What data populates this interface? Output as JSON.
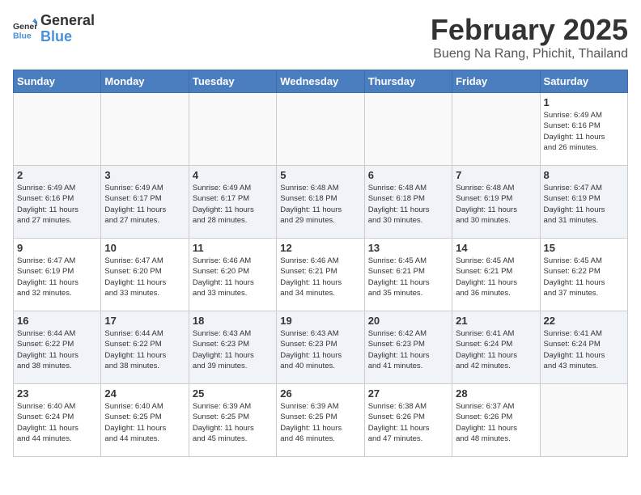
{
  "logo": {
    "general": "General",
    "blue": "Blue"
  },
  "header": {
    "month_year": "February 2025",
    "location": "Bueng Na Rang, Phichit, Thailand"
  },
  "weekdays": [
    "Sunday",
    "Monday",
    "Tuesday",
    "Wednesday",
    "Thursday",
    "Friday",
    "Saturday"
  ],
  "weeks": [
    [
      {
        "day": "",
        "info": ""
      },
      {
        "day": "",
        "info": ""
      },
      {
        "day": "",
        "info": ""
      },
      {
        "day": "",
        "info": ""
      },
      {
        "day": "",
        "info": ""
      },
      {
        "day": "",
        "info": ""
      },
      {
        "day": "1",
        "info": "Sunrise: 6:49 AM\nSunset: 6:16 PM\nDaylight: 11 hours\nand 26 minutes."
      }
    ],
    [
      {
        "day": "2",
        "info": "Sunrise: 6:49 AM\nSunset: 6:16 PM\nDaylight: 11 hours\nand 27 minutes."
      },
      {
        "day": "3",
        "info": "Sunrise: 6:49 AM\nSunset: 6:17 PM\nDaylight: 11 hours\nand 27 minutes."
      },
      {
        "day": "4",
        "info": "Sunrise: 6:49 AM\nSunset: 6:17 PM\nDaylight: 11 hours\nand 28 minutes."
      },
      {
        "day": "5",
        "info": "Sunrise: 6:48 AM\nSunset: 6:18 PM\nDaylight: 11 hours\nand 29 minutes."
      },
      {
        "day": "6",
        "info": "Sunrise: 6:48 AM\nSunset: 6:18 PM\nDaylight: 11 hours\nand 30 minutes."
      },
      {
        "day": "7",
        "info": "Sunrise: 6:48 AM\nSunset: 6:19 PM\nDaylight: 11 hours\nand 30 minutes."
      },
      {
        "day": "8",
        "info": "Sunrise: 6:47 AM\nSunset: 6:19 PM\nDaylight: 11 hours\nand 31 minutes."
      }
    ],
    [
      {
        "day": "9",
        "info": "Sunrise: 6:47 AM\nSunset: 6:19 PM\nDaylight: 11 hours\nand 32 minutes."
      },
      {
        "day": "10",
        "info": "Sunrise: 6:47 AM\nSunset: 6:20 PM\nDaylight: 11 hours\nand 33 minutes."
      },
      {
        "day": "11",
        "info": "Sunrise: 6:46 AM\nSunset: 6:20 PM\nDaylight: 11 hours\nand 33 minutes."
      },
      {
        "day": "12",
        "info": "Sunrise: 6:46 AM\nSunset: 6:21 PM\nDaylight: 11 hours\nand 34 minutes."
      },
      {
        "day": "13",
        "info": "Sunrise: 6:45 AM\nSunset: 6:21 PM\nDaylight: 11 hours\nand 35 minutes."
      },
      {
        "day": "14",
        "info": "Sunrise: 6:45 AM\nSunset: 6:21 PM\nDaylight: 11 hours\nand 36 minutes."
      },
      {
        "day": "15",
        "info": "Sunrise: 6:45 AM\nSunset: 6:22 PM\nDaylight: 11 hours\nand 37 minutes."
      }
    ],
    [
      {
        "day": "16",
        "info": "Sunrise: 6:44 AM\nSunset: 6:22 PM\nDaylight: 11 hours\nand 38 minutes."
      },
      {
        "day": "17",
        "info": "Sunrise: 6:44 AM\nSunset: 6:22 PM\nDaylight: 11 hours\nand 38 minutes."
      },
      {
        "day": "18",
        "info": "Sunrise: 6:43 AM\nSunset: 6:23 PM\nDaylight: 11 hours\nand 39 minutes."
      },
      {
        "day": "19",
        "info": "Sunrise: 6:43 AM\nSunset: 6:23 PM\nDaylight: 11 hours\nand 40 minutes."
      },
      {
        "day": "20",
        "info": "Sunrise: 6:42 AM\nSunset: 6:23 PM\nDaylight: 11 hours\nand 41 minutes."
      },
      {
        "day": "21",
        "info": "Sunrise: 6:41 AM\nSunset: 6:24 PM\nDaylight: 11 hours\nand 42 minutes."
      },
      {
        "day": "22",
        "info": "Sunrise: 6:41 AM\nSunset: 6:24 PM\nDaylight: 11 hours\nand 43 minutes."
      }
    ],
    [
      {
        "day": "23",
        "info": "Sunrise: 6:40 AM\nSunset: 6:24 PM\nDaylight: 11 hours\nand 44 minutes."
      },
      {
        "day": "24",
        "info": "Sunrise: 6:40 AM\nSunset: 6:25 PM\nDaylight: 11 hours\nand 44 minutes."
      },
      {
        "day": "25",
        "info": "Sunrise: 6:39 AM\nSunset: 6:25 PM\nDaylight: 11 hours\nand 45 minutes."
      },
      {
        "day": "26",
        "info": "Sunrise: 6:39 AM\nSunset: 6:25 PM\nDaylight: 11 hours\nand 46 minutes."
      },
      {
        "day": "27",
        "info": "Sunrise: 6:38 AM\nSunset: 6:26 PM\nDaylight: 11 hours\nand 47 minutes."
      },
      {
        "day": "28",
        "info": "Sunrise: 6:37 AM\nSunset: 6:26 PM\nDaylight: 11 hours\nand 48 minutes."
      },
      {
        "day": "",
        "info": ""
      }
    ]
  ]
}
